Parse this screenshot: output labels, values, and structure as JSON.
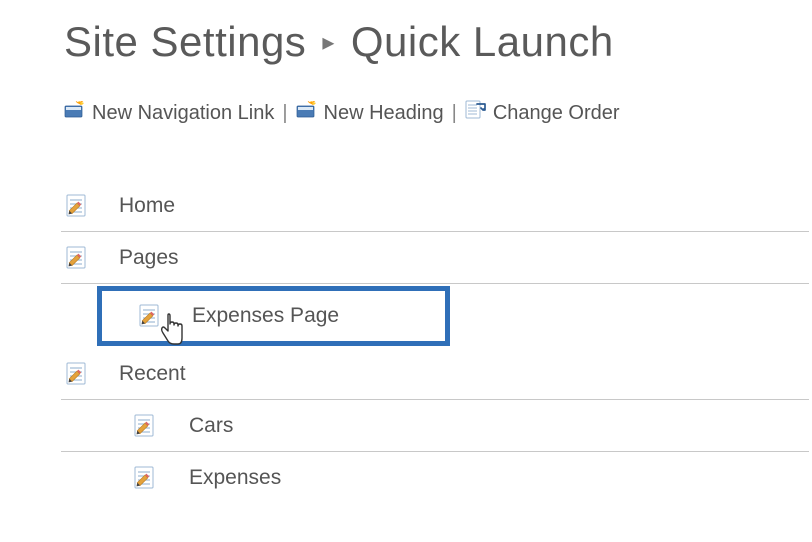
{
  "title": {
    "text_prefix": "Site Settings",
    "separator": "▸",
    "text_current": "Quick Launch"
  },
  "toolbar": {
    "new_link": "New Navigation Link",
    "new_heading": "New Heading",
    "change_order": "Change Order",
    "divider": "|"
  },
  "nav": {
    "home": "Home",
    "pages": "Pages",
    "expenses_page": "Expenses Page",
    "recent": "Recent",
    "cars": "Cars",
    "expenses": "Expenses"
  }
}
